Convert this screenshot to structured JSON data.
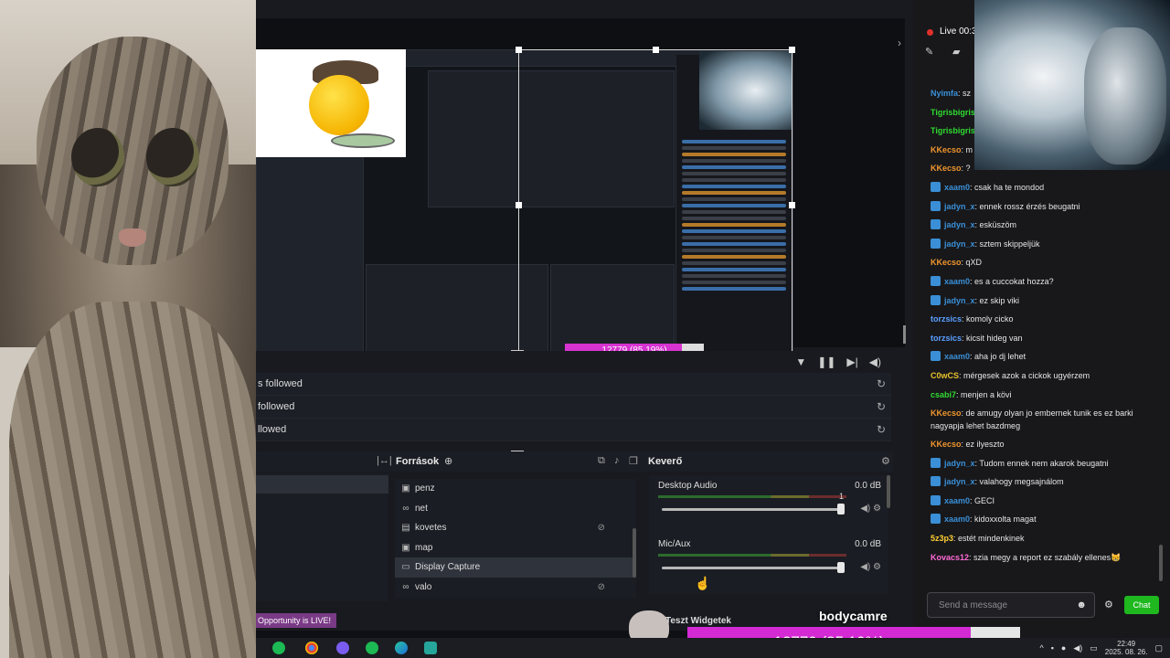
{
  "preview": {
    "nested_progress": "12779 (85.19%)",
    "nested_streamer": "bodycamre",
    "nested_banner": "Opportunity is LIVE!"
  },
  "events": [
    {
      "text": "s followed"
    },
    {
      "text": "followed"
    },
    {
      "text": "llowed"
    }
  ],
  "docks": {
    "sources_title": "Források",
    "mixer_title": "Keverő"
  },
  "sources": [
    {
      "name": "penz",
      "icon": "image-icon"
    },
    {
      "name": "net",
      "icon": "link-icon"
    },
    {
      "name": "kovetes",
      "icon": "browser-icon",
      "hidden": true
    },
    {
      "name": "map",
      "icon": "image-icon"
    },
    {
      "name": "Display Capture",
      "icon": "monitor-icon",
      "selected": true
    },
    {
      "name": "valo",
      "icon": "link-icon",
      "hidden": true
    }
  ],
  "mixer": {
    "channels": [
      {
        "name": "Desktop Audio",
        "db": "0.0 dB",
        "level": 1.0
      },
      {
        "name": "Mic/Aux",
        "db": "0.0 dB",
        "level": 1.0
      }
    ],
    "peak_value": "1"
  },
  "overlay": {
    "stream_banner": "Opportunity is LIVE!",
    "widget_label": "Teszt Widgetek",
    "streamer_name": "bodycamre",
    "progress_label": "12779 (85.19%)",
    "progress_fraction": 0.8519
  },
  "chat": {
    "live_label": "Live 00:3",
    "messages": [
      {
        "user": "Nyimfa",
        "color": "#3a8fd6",
        "text": ": sz",
        "badge": false
      },
      {
        "user": "Tigrisbigris",
        "color": "#2fdc2f",
        "text": "",
        "badge": false
      },
      {
        "user": "Tigrisbigris",
        "color": "#2fdc2f",
        "text": "",
        "badge": false
      },
      {
        "user": "KKecso",
        "color": "#f0962d",
        "text": ": m",
        "badge": false
      },
      {
        "user": "KKecso",
        "color": "#f0962d",
        "text": ": ?",
        "badge": false
      },
      {
        "user": "xaam0",
        "color": "#3a8fd6",
        "text": ": csak ha te mondod",
        "badge": true
      },
      {
        "user": "jadyn_x",
        "color": "#3a8fd6",
        "text": ": ennek rossz érzés beugatni",
        "badge": true
      },
      {
        "user": "jadyn_x",
        "color": "#3a8fd6",
        "text": ": esküszöm",
        "badge": true
      },
      {
        "user": "jadyn_x",
        "color": "#3a8fd6",
        "text": ": sztem skippeljük",
        "badge": true
      },
      {
        "user": "KKecso",
        "color": "#f0962d",
        "text": ": qXD",
        "badge": false
      },
      {
        "user": "xaam0",
        "color": "#3a8fd6",
        "text": ": es a cuccokat hozza?",
        "badge": true
      },
      {
        "user": "jadyn_x",
        "color": "#3a8fd6",
        "text": ": ez skip viki",
        "badge": true
      },
      {
        "user": "torzsics",
        "color": "#5aa0ff",
        "text": ": komoly cicko",
        "badge": false
      },
      {
        "user": "torzsics",
        "color": "#5aa0ff",
        "text": ": kicsit hideg van",
        "badge": false
      },
      {
        "user": "xaam0",
        "color": "#3a8fd6",
        "text": ": aha jo dj lehet",
        "badge": true
      },
      {
        "user": "C0wCS",
        "color": "#e8c02d",
        "text": ": mérgesek azok a cickok ugyérzem",
        "badge": false
      },
      {
        "user": "csabi7",
        "color": "#2fdc2f",
        "text": ": menjen a kövi",
        "badge": false
      },
      {
        "user": "KKecso",
        "color": "#f0962d",
        "text": ": de amugy olyan jo embernek tunik es ez barki nagyapja lehet bazdmeg",
        "badge": false,
        "wrap": true
      },
      {
        "user": "KKecso",
        "color": "#f0962d",
        "text": ": ez ilyeszto",
        "badge": false
      },
      {
        "user": "jadyn_x",
        "color": "#3a8fd6",
        "text": ": Tudom ennek nem akarok beugatni",
        "badge": true
      },
      {
        "user": "jadyn_x",
        "color": "#3a8fd6",
        "text": ": valahogy megsajnálom",
        "badge": true
      },
      {
        "user": "xaam0",
        "color": "#3a8fd6",
        "text": ": GECI",
        "badge": true
      },
      {
        "user": "xaam0",
        "color": "#3a8fd6",
        "text": ": kidoxxolta magat",
        "badge": true
      },
      {
        "user": "5z3p3",
        "color": "#ffcf33",
        "text": ": estét mindenkinek",
        "badge": false
      },
      {
        "user": "Kovacs12",
        "color": "#ff6ad5",
        "text": ": szia megy a report ez szabály ellenes😸",
        "badge": false
      }
    ],
    "input_placeholder": "Send a message",
    "send_label": "Chat"
  },
  "taskbar": {
    "time": "22:49",
    "date": "2025. 08. 26."
  }
}
